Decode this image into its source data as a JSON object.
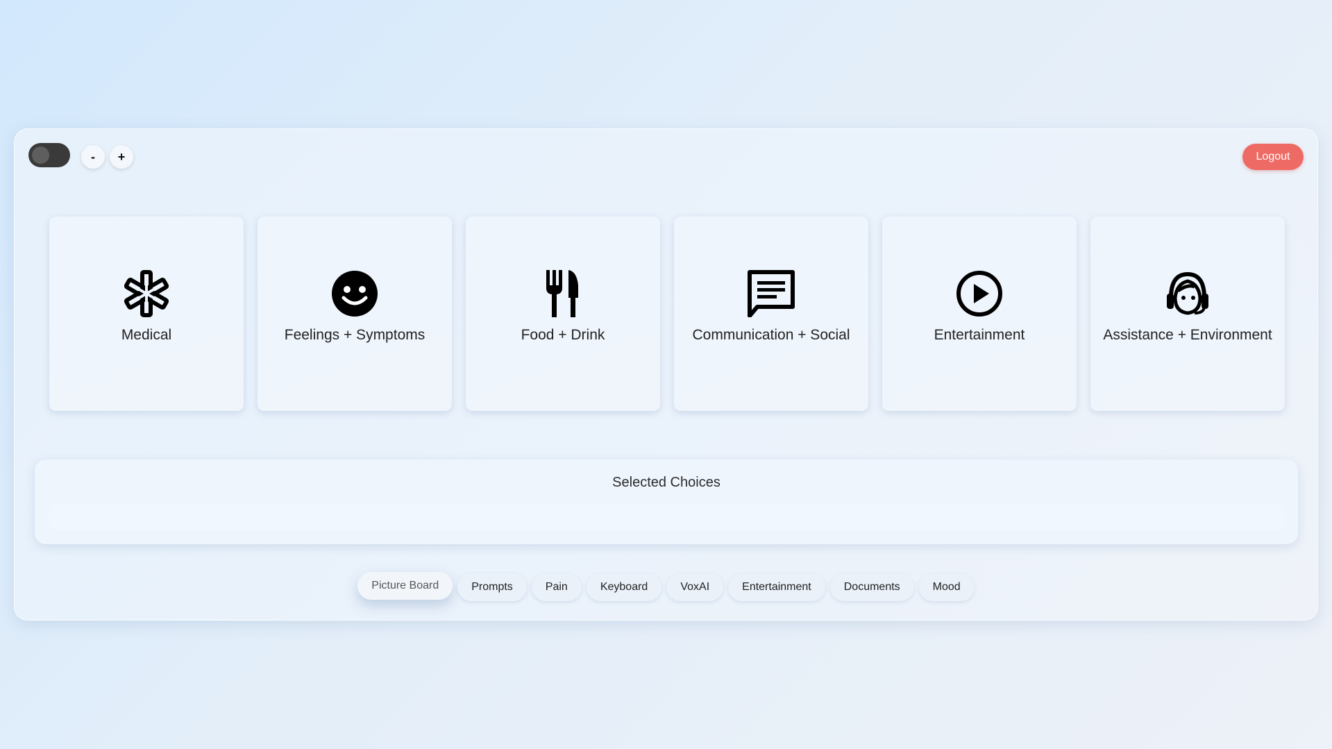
{
  "toolbar": {
    "zoom_out_label": "-",
    "zoom_in_label": "+",
    "logout_label": "Logout",
    "logout_color": "#ee6a64"
  },
  "categories": [
    {
      "label": "Medical",
      "icon": "medical-star-icon"
    },
    {
      "label": "Feelings + Symptoms",
      "icon": "smiley-face-icon"
    },
    {
      "label": "Food + Drink",
      "icon": "fork-knife-icon"
    },
    {
      "label": "Communication + Social",
      "icon": "chat-message-icon"
    },
    {
      "label": "Entertainment",
      "icon": "play-circle-icon"
    },
    {
      "label": "Assistance + Environment",
      "icon": "support-agent-icon"
    }
  ],
  "selected": {
    "title": "Selected Choices"
  },
  "tabs": [
    {
      "label": "Picture Board",
      "active": true
    },
    {
      "label": "Prompts"
    },
    {
      "label": "Pain"
    },
    {
      "label": "Keyboard"
    },
    {
      "label": "VoxAI"
    },
    {
      "label": "Entertainment"
    },
    {
      "label": "Documents"
    },
    {
      "label": "Mood"
    }
  ]
}
